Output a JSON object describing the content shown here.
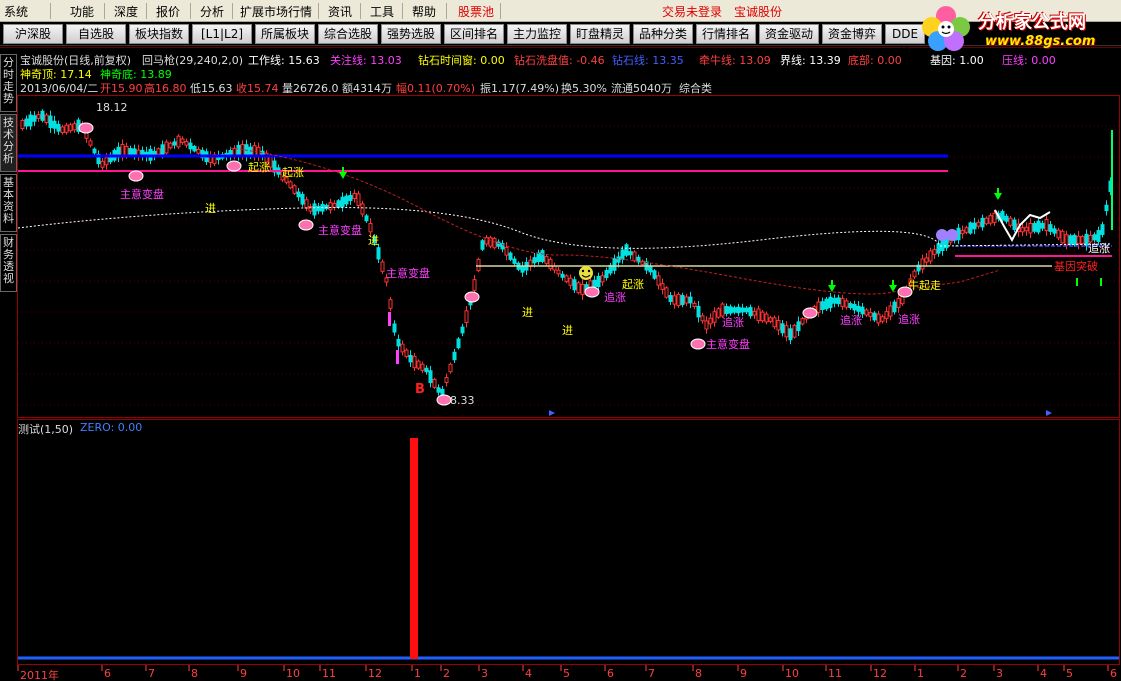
{
  "menu": {
    "items": [
      "系统",
      "功能",
      "深度",
      "报价",
      "分析",
      "扩展市场行情",
      "资讯",
      "工具",
      "帮助"
    ],
    "stock_pool": "股票池",
    "trade_status": "交易未登录",
    "current_stock": "宝诚股份"
  },
  "toolbar": {
    "buttons": [
      "沪深股",
      "自选股",
      "板块指数",
      "[L1|L2]",
      "所属板块",
      "综合选股",
      "强势选股",
      "区间排名",
      "主力监控",
      "盯盘精灵",
      "品种分类",
      "行情排名",
      "资金驱动",
      "资金博弈",
      "DDE排"
    ]
  },
  "logo": {
    "title": "分析家公式网",
    "url": "www.88gs.com"
  },
  "side_tabs": [
    "分时走势",
    "技术分析",
    "基本资料",
    "财务透视"
  ],
  "header": {
    "line1": {
      "title": "宝诚股份(日线,前复权)",
      "indicator": "回马枪(29,240,2,0)",
      "work_line": "工作线: 15.63",
      "focus_line": "关注线: 13.03",
      "diamond_window": "钻石时间窗: 0.00",
      "diamond_wash": "钻石洗盘值: -0.46",
      "diamond_line": "钻石线: 13.35",
      "bull_line": "牵牛线: 13.09",
      "boundary": "界线: 13.39",
      "bottom": "底部: 0.00",
      "gene": "基因: 1.00",
      "pressure": "压线: 0.00"
    },
    "line2": {
      "top": "神奇顶: 17.14",
      "bottom": "神奇底: 13.89"
    },
    "line3": {
      "date": "2013/06/04/二",
      "open": "开15.90",
      "high": "高16.80",
      "low": "低15.63",
      "close": "收15.74",
      "volume": "量26726.0",
      "amount": "额4314万",
      "change": "幅0.11(0.70%)",
      "amplitude": "振1.17(7.49%)",
      "turnover": "换5.30%",
      "float": "流通5040万",
      "category": "综合类"
    }
  },
  "chart_labels": {
    "high_price": "18.12",
    "low_price": "8.33",
    "buy_marker": "B",
    "annotations": [
      "起涨",
      "起涨",
      "主意变盘",
      "主意变盘",
      "主意变盘",
      "进",
      "进",
      "进",
      "进",
      "起涨",
      "追涨",
      "追涨",
      "追涨",
      "追涨",
      "追涨",
      "主意变盘",
      "牛起走",
      "基因突破"
    ]
  },
  "subchart": {
    "title": "测试(1,50)",
    "zero": "ZERO: 0.00"
  },
  "xaxis": {
    "labels": [
      "2011年",
      "6",
      "7",
      "8",
      "9",
      "10",
      "11",
      "12",
      "1",
      "2",
      "3",
      "4",
      "5",
      "6",
      "7",
      "8",
      "9",
      "10",
      "11",
      "12",
      "1",
      "2",
      "3",
      "4",
      "5",
      "6"
    ]
  },
  "colors": {
    "up": "#ff3232",
    "down": "#00e0e0",
    "blue_line": "#0000ff",
    "pink_line": "#ff1493",
    "text_yellow": "#ffff00",
    "text_red": "#ff4040",
    "text_cyan": "#40c0ff"
  }
}
